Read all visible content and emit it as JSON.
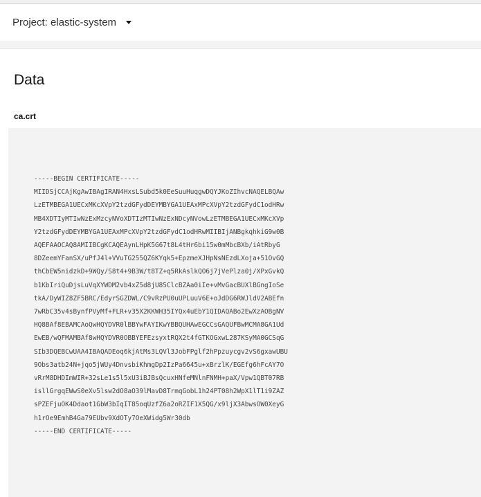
{
  "project_bar": {
    "label": "Project: elastic-system",
    "dropdown_icon": "caret-down-icon"
  },
  "section": {
    "title": "Data",
    "key": "ca.crt"
  },
  "certificate": {
    "lines": [
      "-----BEGIN CERTIFICATE-----",
      "MIIDSjCCAjKgAwIBAgIRAN4HxsLSubd5k0EeSuuHuqgwDQYJKoZIhvcNAQELBQAw",
      "LzETMBEGA1UECxMKcXVpY2tzdGFydDEYMBYGA1UEAxMPcXVpY2tzdGFydC1odHRw",
      "MB4XDTIyMTIwNzExMzcyNVoXDTIzMTIwNzExNDcyNVowLzETMBEGA1UECxMKcXVp",
      "Y2tzdGFydDEYMBYGA1UEAxMPcXVpY2tzdGFydC1odHRwMIIBIjANBgkqhkiG9w0B",
      "AQEFAAOCAQ8AMIIBCgKCAQEAynLHpK5G67t8L4tHr6bi15w0mMbcBXb/iAtRbyG",
      "8DZeemYFanSX/uPfJ4l+VVuTG255QZ6KYqk5+EpzmeXJHpNsNEzdLXoja+51OvGQ",
      "thCbEW5nidzkD+9WQy/S8t4+9B3W/t8TZ+q5RkAslkQO6j7jVePlza0j/XPxGvkQ",
      "b1KbIriQuDjsLuVqXYWDM2vb4xZ5d8jU85ClcBZAa0iIe+vMvGacBUXlBGngIoSe",
      "tkA/DyWIZ8ZF5BRC/EdyrSGZDWL/C9vRzPU0uUPLuuV6E+oJdDG6RWJldV2ABEfn",
      "7wRbC35v4sBynfPVyMf+FLR+v35X2KKWH35IYQx4uEbY1QIDAQABo2EwXzAOBgNV",
      "HQ8BAf8EBAMCAoQwHQYDVR0lBBYwFAYIKwYBBQUHAwEGCCsGAQUFBwMCMA8GA1Ud",
      "EwEB/wQFMAMBAf8wHQYDVR0OBBYEFEzsyxtRQX2t4fGTKOGxwL287KSyMA0GCSqG",
      "SIb3DQEBCwUAA4IBAQADEoq6kjAtMs3LQVl3JobFPglf2hPpzuycgv2vS6gxawUBU",
      "9Obs3atb24N+jqo5jWUy4DnvsbiKhmgDp2IzPa6645u+xBrzlK/EGEfg6hFcAY7O",
      "vRrM8DHDImWIR+32sLe1s5l5xU3iBJBsQcuxHNfeMNlnFNMH+paX/Vpw1QBT07RB",
      "isllGrgqEWwS0eXv5lsw2dO8aO39lMavD8TrmqGobL1h24PT08h2WpX1lT1i9ZAZ",
      "sPZEFjuOK4Ddaot1GbW3bIqIT85oqUzfZ6a2oRZIF1X5QG/x9ljX3AbwsOW0XeyG",
      "h1rOe9EmhB4Ga79EUbv9XdOTy7OeXWidg5Wr30db",
      "-----END CERTIFICATE-----"
    ]
  }
}
